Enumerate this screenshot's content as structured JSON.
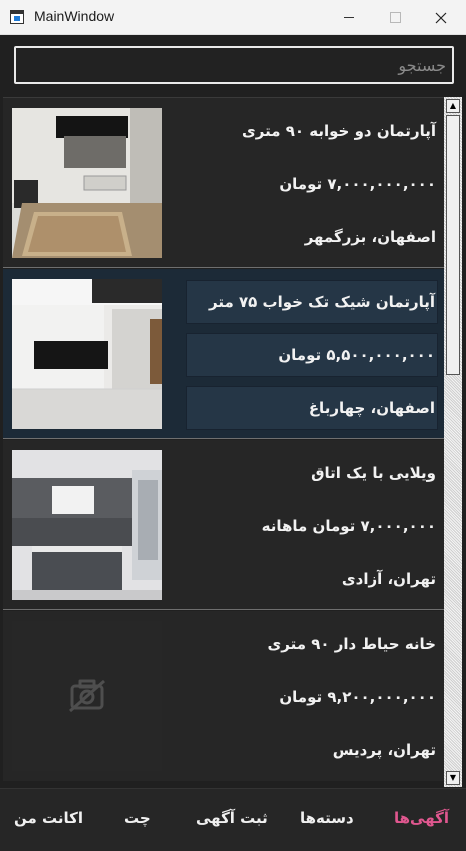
{
  "window": {
    "title": "MainWindow"
  },
  "search": {
    "placeholder": "جستجو",
    "value": ""
  },
  "listings": [
    {
      "title": "آپارتمان دو خوابه ۹۰ متری",
      "price": "۷,۰۰۰,۰۰۰,۰۰۰ تومان",
      "location": "اصفهان، بزرگمهر",
      "image": "living-room-photo"
    },
    {
      "title": "آپارتمان شیک تک خواب ۷۵ متر",
      "price": "۵,۵۰۰,۰۰۰,۰۰۰ تومان",
      "location": "اصفهان، چهارباغ",
      "image": "kitchen-photo",
      "selected": true
    },
    {
      "title": "ویلایی با یک اتاق",
      "price": "۷,۰۰۰,۰۰۰ تومان ماهانه",
      "location": "تهران، آزادی",
      "image": "open-kitchen-photo"
    },
    {
      "title": "خانه حیاط دار ۹۰ متری",
      "price": "۹,۲۰۰,۰۰۰,۰۰۰ تومان",
      "location": "تهران، پردیس",
      "image": "no-image-icon"
    }
  ],
  "nav": {
    "ads": "آگهی‌ها",
    "categories": "دسته‌ها",
    "post_ad": "ثبت آگهی",
    "chat": "چت",
    "my_account": "اکانت من"
  },
  "colors": {
    "active_tab": "#e0578f",
    "selected_card": "#1c2a37",
    "background": "#202020"
  }
}
